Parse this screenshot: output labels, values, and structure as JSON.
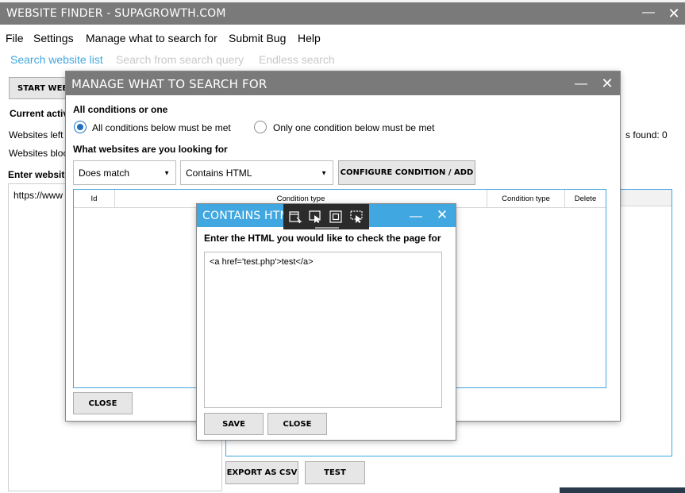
{
  "main_window": {
    "title": "WEBSITE FINDER - SUPAGROWTH.COM",
    "menu": [
      "File",
      "Settings",
      "Manage what to search for",
      "Submit Bug",
      "Help"
    ],
    "tabs": [
      "Search website list",
      "Search from search query",
      "Endless search"
    ],
    "start_button": "START WEBS",
    "current_label": "Current activ",
    "websites_left": "Websites left",
    "websites_blocked": "Websites bloc",
    "enter_websites": "Enter website",
    "url_value": "https://www",
    "found_label": "s found: 0",
    "export_button": "EXPORT AS CSV",
    "test_button": "TEST"
  },
  "manage_dialog": {
    "title": "MANAGE WHAT TO SEARCH FOR",
    "conditions_heading": "All conditions or one",
    "radio_all": "All conditions below must be met",
    "radio_one": "Only one condition below must be met",
    "looking_for_heading": "What websites are you looking for",
    "match_select": "Does match",
    "type_select": "Contains HTML",
    "configure_button": "CONFIGURE CONDITION / ADD",
    "table_headers": [
      "Id",
      "Condition type",
      "Condition type",
      "Delete"
    ],
    "close_button": "CLOSE"
  },
  "contains_dialog": {
    "title": "CONTAINS HTM",
    "prompt": "Enter the HTML you would like to check the page for",
    "html_value": "<a href='test.php'>test</a>",
    "save_button": "SAVE",
    "close_button": "CLOSE"
  },
  "colors": {
    "title_gray": "#7a7a7a",
    "accent_blue": "#41a7e0",
    "radio_blue": "#1e6fc4"
  }
}
